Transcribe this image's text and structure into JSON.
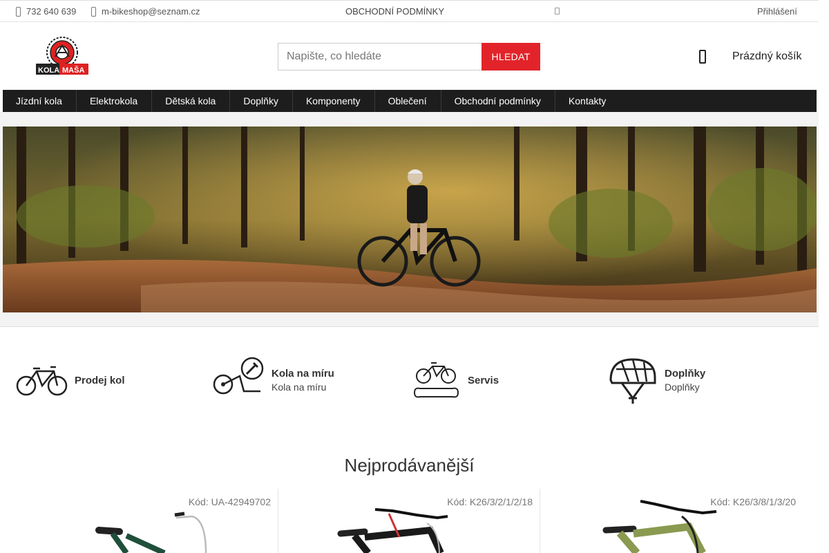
{
  "topbar": {
    "phone": "732 640 639",
    "email": "m-bikeshop@seznam.cz",
    "terms": "OBCHODNÍ PODMÍNKY",
    "login": "Přihlášení"
  },
  "logo": {
    "text_top": "KOLA",
    "text_bottom": "MAŠA"
  },
  "search": {
    "placeholder": "Napište, co hledáte",
    "button": "HLEDAT"
  },
  "cart": {
    "label": "Prázdný košík"
  },
  "nav": {
    "items": [
      "Jízdní kola",
      "Elektrokola",
      "Dětská kola",
      "Doplňky",
      "Komponenty",
      "Oblečení",
      "Obchodní podmínky",
      "Kontakty"
    ]
  },
  "features": [
    {
      "title": "Prodej kol",
      "subtitle": "",
      "icon": "bicycle-icon"
    },
    {
      "title": "Kola na míru",
      "subtitle": "Kola na míru",
      "icon": "bike-wrench-icon"
    },
    {
      "title": "Servis",
      "subtitle": "",
      "icon": "bike-service-icon"
    },
    {
      "title": "Doplňky",
      "subtitle": "Doplňky",
      "icon": "helmet-icon"
    }
  ],
  "bestsellers": {
    "title": "Nejprodávanější",
    "products": [
      {
        "code": "Kód: UA-42949702",
        "frame_color": "#1f4f3a"
      },
      {
        "code": "Kód: K26/3/2/1/2/18",
        "frame_color": "#1a1a1a"
      },
      {
        "code": "Kód: K26/3/8/1/3/20",
        "frame_color": "#8a9a50"
      }
    ]
  },
  "colors": {
    "accent": "#e2242a",
    "nav_bg": "#1d1d1d"
  }
}
